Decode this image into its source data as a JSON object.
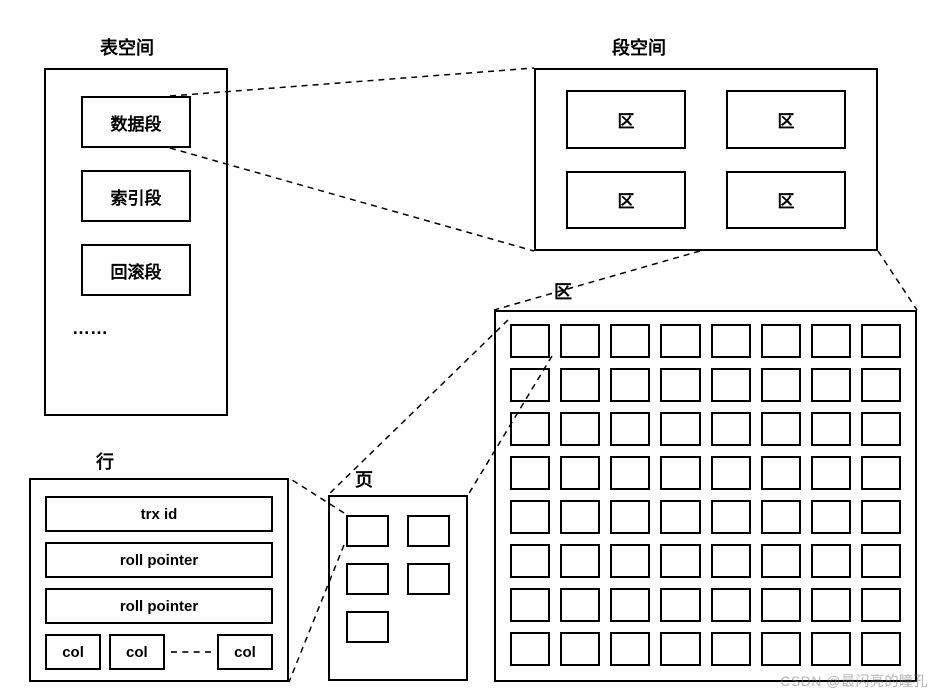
{
  "labels": {
    "tablespace": "表空间",
    "segspace": "段空间",
    "extent": "区",
    "page": "页",
    "row": "行"
  },
  "tablespace": {
    "items": [
      "数据段",
      "索引段",
      "回滚段"
    ],
    "more": "……"
  },
  "segspace": {
    "cells": [
      "区",
      "区",
      "区",
      "区"
    ]
  },
  "extent": {
    "rows": 8,
    "cols": 8
  },
  "page": {
    "cells": 5
  },
  "row": {
    "items": [
      "trx id",
      "roll pointer",
      "roll pointer"
    ],
    "cols": [
      "col",
      "col",
      "col"
    ]
  },
  "watermark": "CSDN @最闪亮的瞳孔"
}
